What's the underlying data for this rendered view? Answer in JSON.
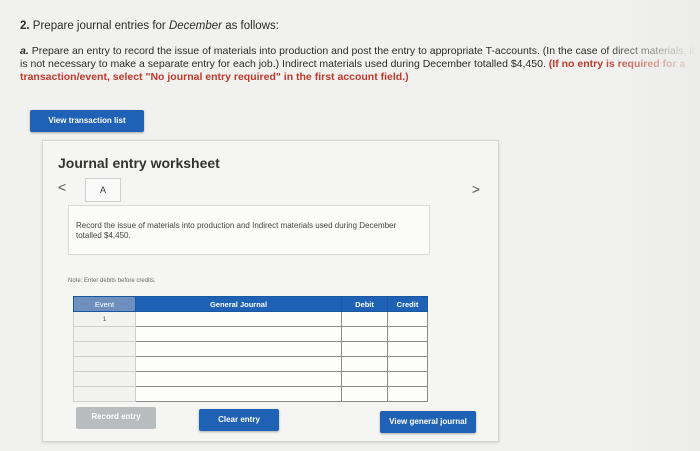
{
  "question": {
    "number": "2.",
    "title_pre": "Prepare journal entries for ",
    "title_italic": "December",
    "title_post": " as follows:",
    "part_label": "a.",
    "body": "Prepare an entry to record the issue of materials into production and post the entry to appropriate T-accounts. (In the case of direct materials, it is not necessary to make a separate entry for each job.) Indirect materials used during December totalled $4,450. ",
    "note_red": "(If no entry is required for a transaction/event, select \"No journal entry required\" in the first account field.)"
  },
  "buttons": {
    "view_transaction_list": "View transaction list",
    "record_entry": "Record entry",
    "clear_entry": "Clear entry",
    "view_general_journal": "View general journal"
  },
  "worksheet": {
    "title": "Journal entry worksheet",
    "prev_arrow": "<",
    "next_arrow": ">",
    "tab_label": "A",
    "description": "Record the issue of materials into production and Indirect materials used during December totalled $4,450.",
    "note": "Note: Enter debits before credits.",
    "columns": [
      "Event",
      "General Journal",
      "Debit",
      "Credit"
    ],
    "rows": [
      {
        "event": "1",
        "account": "",
        "debit": "",
        "credit": ""
      },
      {
        "event": "",
        "account": "",
        "debit": "",
        "credit": ""
      },
      {
        "event": "",
        "account": "",
        "debit": "",
        "credit": ""
      },
      {
        "event": "",
        "account": "",
        "debit": "",
        "credit": ""
      },
      {
        "event": "",
        "account": "",
        "debit": "",
        "credit": ""
      },
      {
        "event": "",
        "account": "",
        "debit": "",
        "credit": ""
      }
    ]
  },
  "colors": {
    "primary_button": "#1f62b5",
    "disabled_button": "#b9bcbf",
    "instruction_red": "#c0392b"
  }
}
